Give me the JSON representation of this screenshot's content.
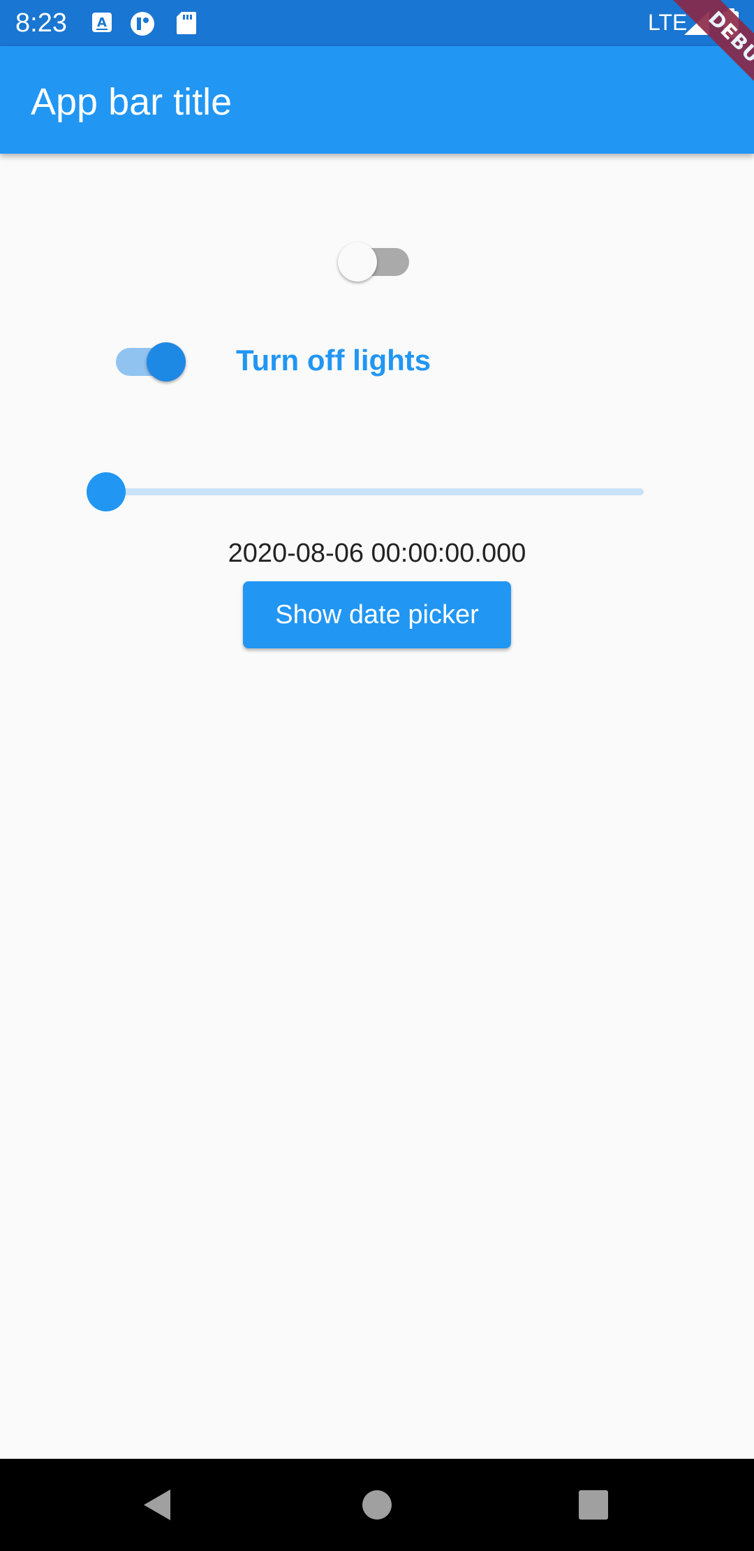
{
  "status_bar": {
    "time": "8:23",
    "network": "LTE",
    "icons": [
      "autofill-icon",
      "notification-icon",
      "sd-card-icon",
      "signal-icon",
      "battery-icon"
    ]
  },
  "debug_banner": {
    "label": "DEBUG"
  },
  "app_bar": {
    "title": "App bar title"
  },
  "main": {
    "switch_one": {
      "on": false
    },
    "switch_two": {
      "on": true,
      "label": "Turn off lights"
    },
    "slider": {
      "value": 0.0,
      "min": 0,
      "max": 1
    },
    "date_text": "2020-08-06 00:00:00.000",
    "date_button_label": "Show date picker"
  },
  "nav_bar": {
    "icons": [
      "back-icon",
      "home-icon",
      "recents-icon"
    ]
  },
  "colors": {
    "primary": "#2196f3",
    "status_bar": "#1976d2",
    "background": "#fafafa",
    "debug_ribbon": "#8b2846"
  }
}
